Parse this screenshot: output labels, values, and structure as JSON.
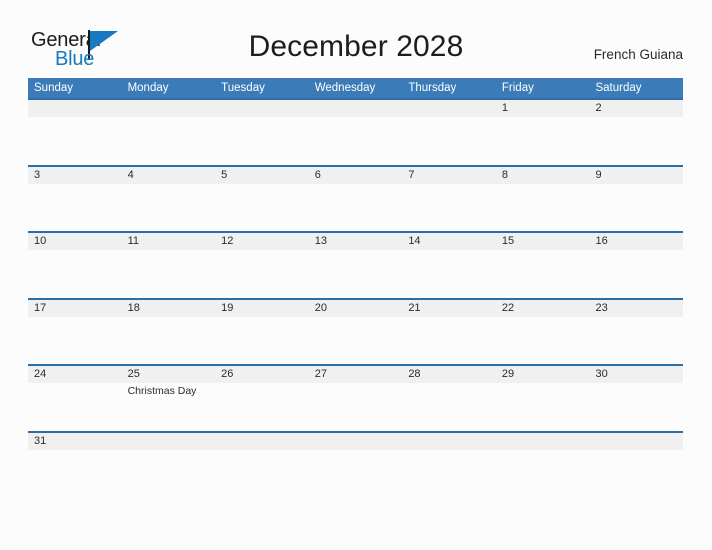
{
  "brand": {
    "word_one": "General",
    "word_two": "Blue",
    "flag_icon": "flag-triangle-icon",
    "accent_color": "#1878c0"
  },
  "header": {
    "title": "December 2028",
    "locale": "French Guiana"
  },
  "colors": {
    "header_blue": "#3b7cb8",
    "row_divider_blue": "#2a6da8",
    "date_band_gray": "#f0f0f0",
    "page_background": "#fcfcfc",
    "text_dark": "#2b2b2b"
  },
  "calendar": {
    "month": "December",
    "year": "2028",
    "weekday_headers": [
      "Sunday",
      "Monday",
      "Tuesday",
      "Wednesday",
      "Thursday",
      "Friday",
      "Saturday"
    ],
    "weeks": [
      [
        {
          "date": "",
          "event": ""
        },
        {
          "date": "",
          "event": ""
        },
        {
          "date": "",
          "event": ""
        },
        {
          "date": "",
          "event": ""
        },
        {
          "date": "",
          "event": ""
        },
        {
          "date": "1",
          "event": ""
        },
        {
          "date": "2",
          "event": ""
        }
      ],
      [
        {
          "date": "3",
          "event": ""
        },
        {
          "date": "4",
          "event": ""
        },
        {
          "date": "5",
          "event": ""
        },
        {
          "date": "6",
          "event": ""
        },
        {
          "date": "7",
          "event": ""
        },
        {
          "date": "8",
          "event": ""
        },
        {
          "date": "9",
          "event": ""
        }
      ],
      [
        {
          "date": "10",
          "event": ""
        },
        {
          "date": "11",
          "event": ""
        },
        {
          "date": "12",
          "event": ""
        },
        {
          "date": "13",
          "event": ""
        },
        {
          "date": "14",
          "event": ""
        },
        {
          "date": "15",
          "event": ""
        },
        {
          "date": "16",
          "event": ""
        }
      ],
      [
        {
          "date": "17",
          "event": ""
        },
        {
          "date": "18",
          "event": ""
        },
        {
          "date": "19",
          "event": ""
        },
        {
          "date": "20",
          "event": ""
        },
        {
          "date": "21",
          "event": ""
        },
        {
          "date": "22",
          "event": ""
        },
        {
          "date": "23",
          "event": ""
        }
      ],
      [
        {
          "date": "24",
          "event": ""
        },
        {
          "date": "25",
          "event": "Christmas Day"
        },
        {
          "date": "26",
          "event": ""
        },
        {
          "date": "27",
          "event": ""
        },
        {
          "date": "28",
          "event": ""
        },
        {
          "date": "29",
          "event": ""
        },
        {
          "date": "30",
          "event": ""
        }
      ],
      [
        {
          "date": "31",
          "event": ""
        },
        {
          "date": "",
          "event": ""
        },
        {
          "date": "",
          "event": ""
        },
        {
          "date": "",
          "event": ""
        },
        {
          "date": "",
          "event": ""
        },
        {
          "date": "",
          "event": ""
        },
        {
          "date": "",
          "event": ""
        }
      ]
    ]
  }
}
